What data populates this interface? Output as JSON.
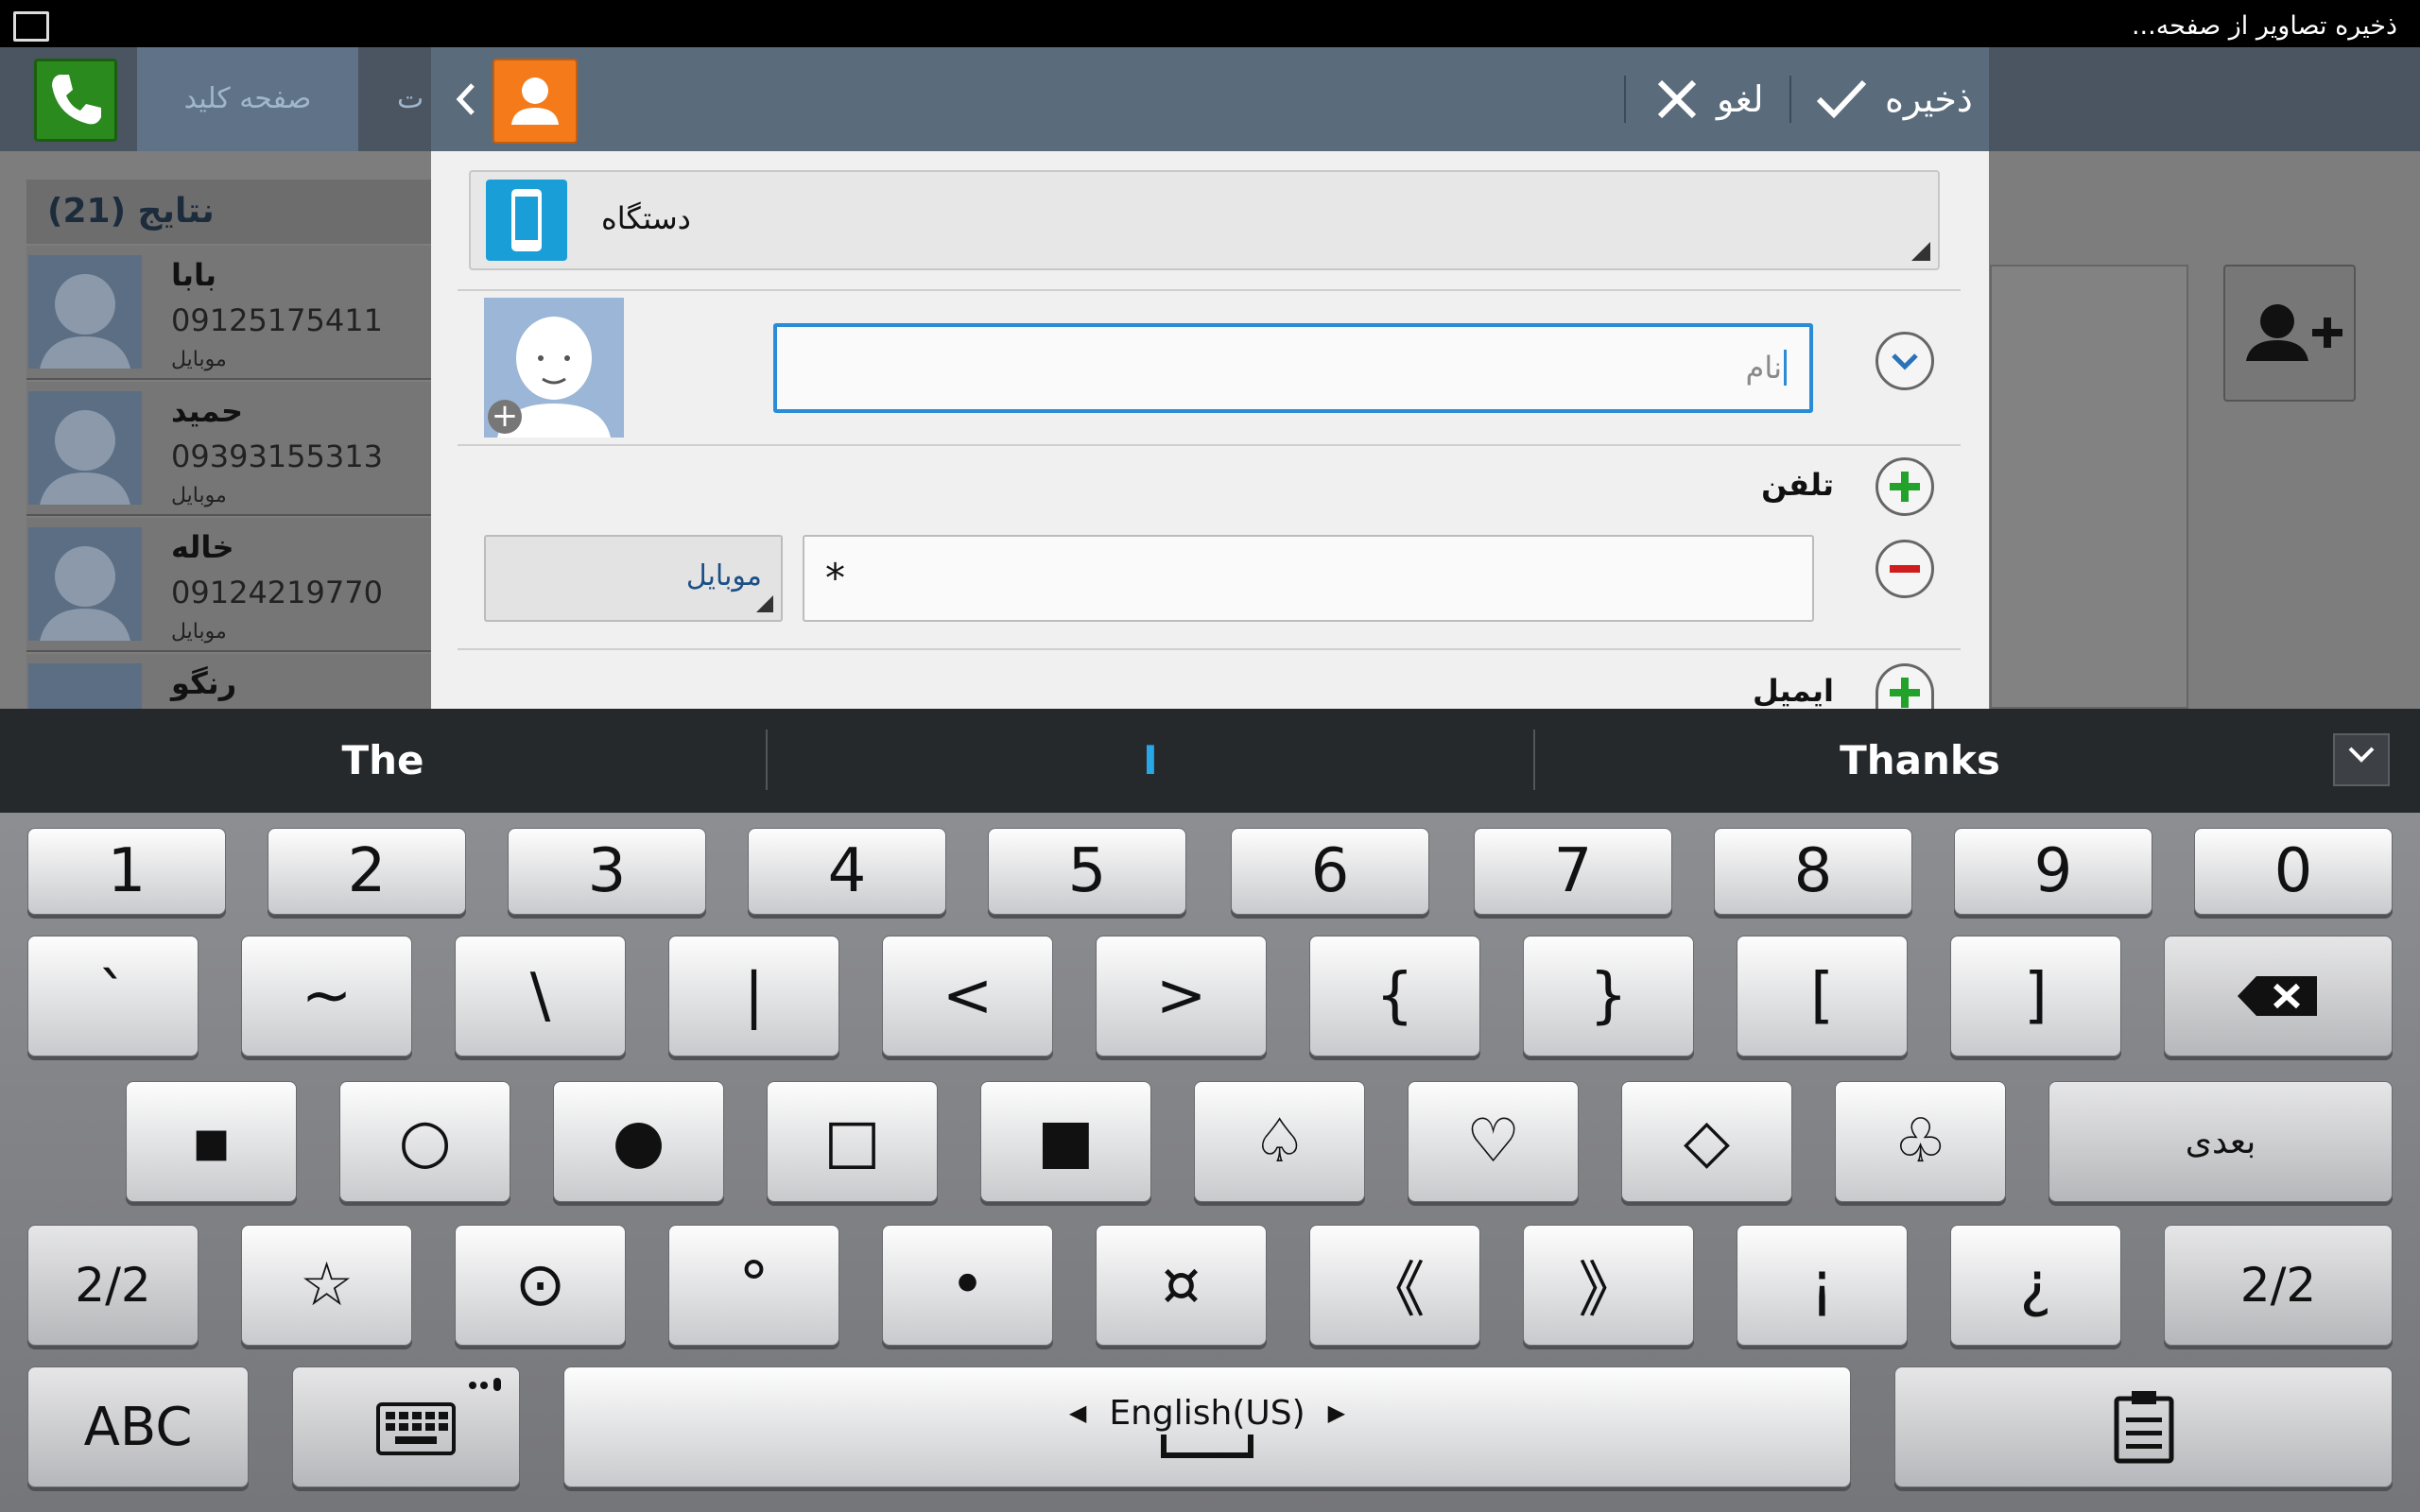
{
  "status_bar": {
    "notification_text": "ذخیره تصاویر از صفحه..."
  },
  "contacts_app": {
    "tabs": [
      {
        "label": "صفحه کلید"
      },
      {
        "label": "ت"
      }
    ],
    "results_header": "نتایج (21)",
    "contacts": [
      {
        "name": "بابا",
        "number": "09125175411",
        "type": "موبایل"
      },
      {
        "name": "حمید",
        "number": "09393155313",
        "type": "موبایل"
      },
      {
        "name": "خاله",
        "number": "09124219770",
        "type": "موبایل"
      },
      {
        "name": "رنگو",
        "number": "",
        "type": ""
      }
    ]
  },
  "dialog": {
    "cancel_label": "لغو",
    "save_label": "ذخیره",
    "account_label": "دستگاه",
    "name_placeholder": "نام",
    "phone_section_label": "تلفن",
    "phone_type": "موبایل",
    "phone_value": "*",
    "email_section_label": "ایمیل"
  },
  "suggestions": [
    "The",
    "I",
    "Thanks"
  ],
  "keyboard": {
    "row1": [
      "1",
      "2",
      "3",
      "4",
      "5",
      "6",
      "7",
      "8",
      "9",
      "0"
    ],
    "row2": [
      "`",
      "~",
      "\\",
      "|",
      "<",
      ">",
      "{",
      "}",
      "[",
      "]"
    ],
    "row3": [
      "▪",
      "○",
      "●",
      "□",
      "■",
      "♤",
      "♡",
      "◇",
      "♧"
    ],
    "row3_next": "بعدی",
    "row4_page": "2/2",
    "row4": [
      "☆",
      "⊙",
      "°",
      "•",
      "¤",
      "《",
      "》",
      "¡",
      "¿"
    ],
    "abc_label": "ABC",
    "language_label": "English(US)"
  },
  "colors": {
    "dialog_header": "#5a6b7c",
    "input_focus": "#2a8bd6",
    "add_green": "#22a22a",
    "remove_red": "#d01c1c",
    "contact_icon_orange": "#f47a1a",
    "device_icon_blue": "#1a9ed8"
  }
}
